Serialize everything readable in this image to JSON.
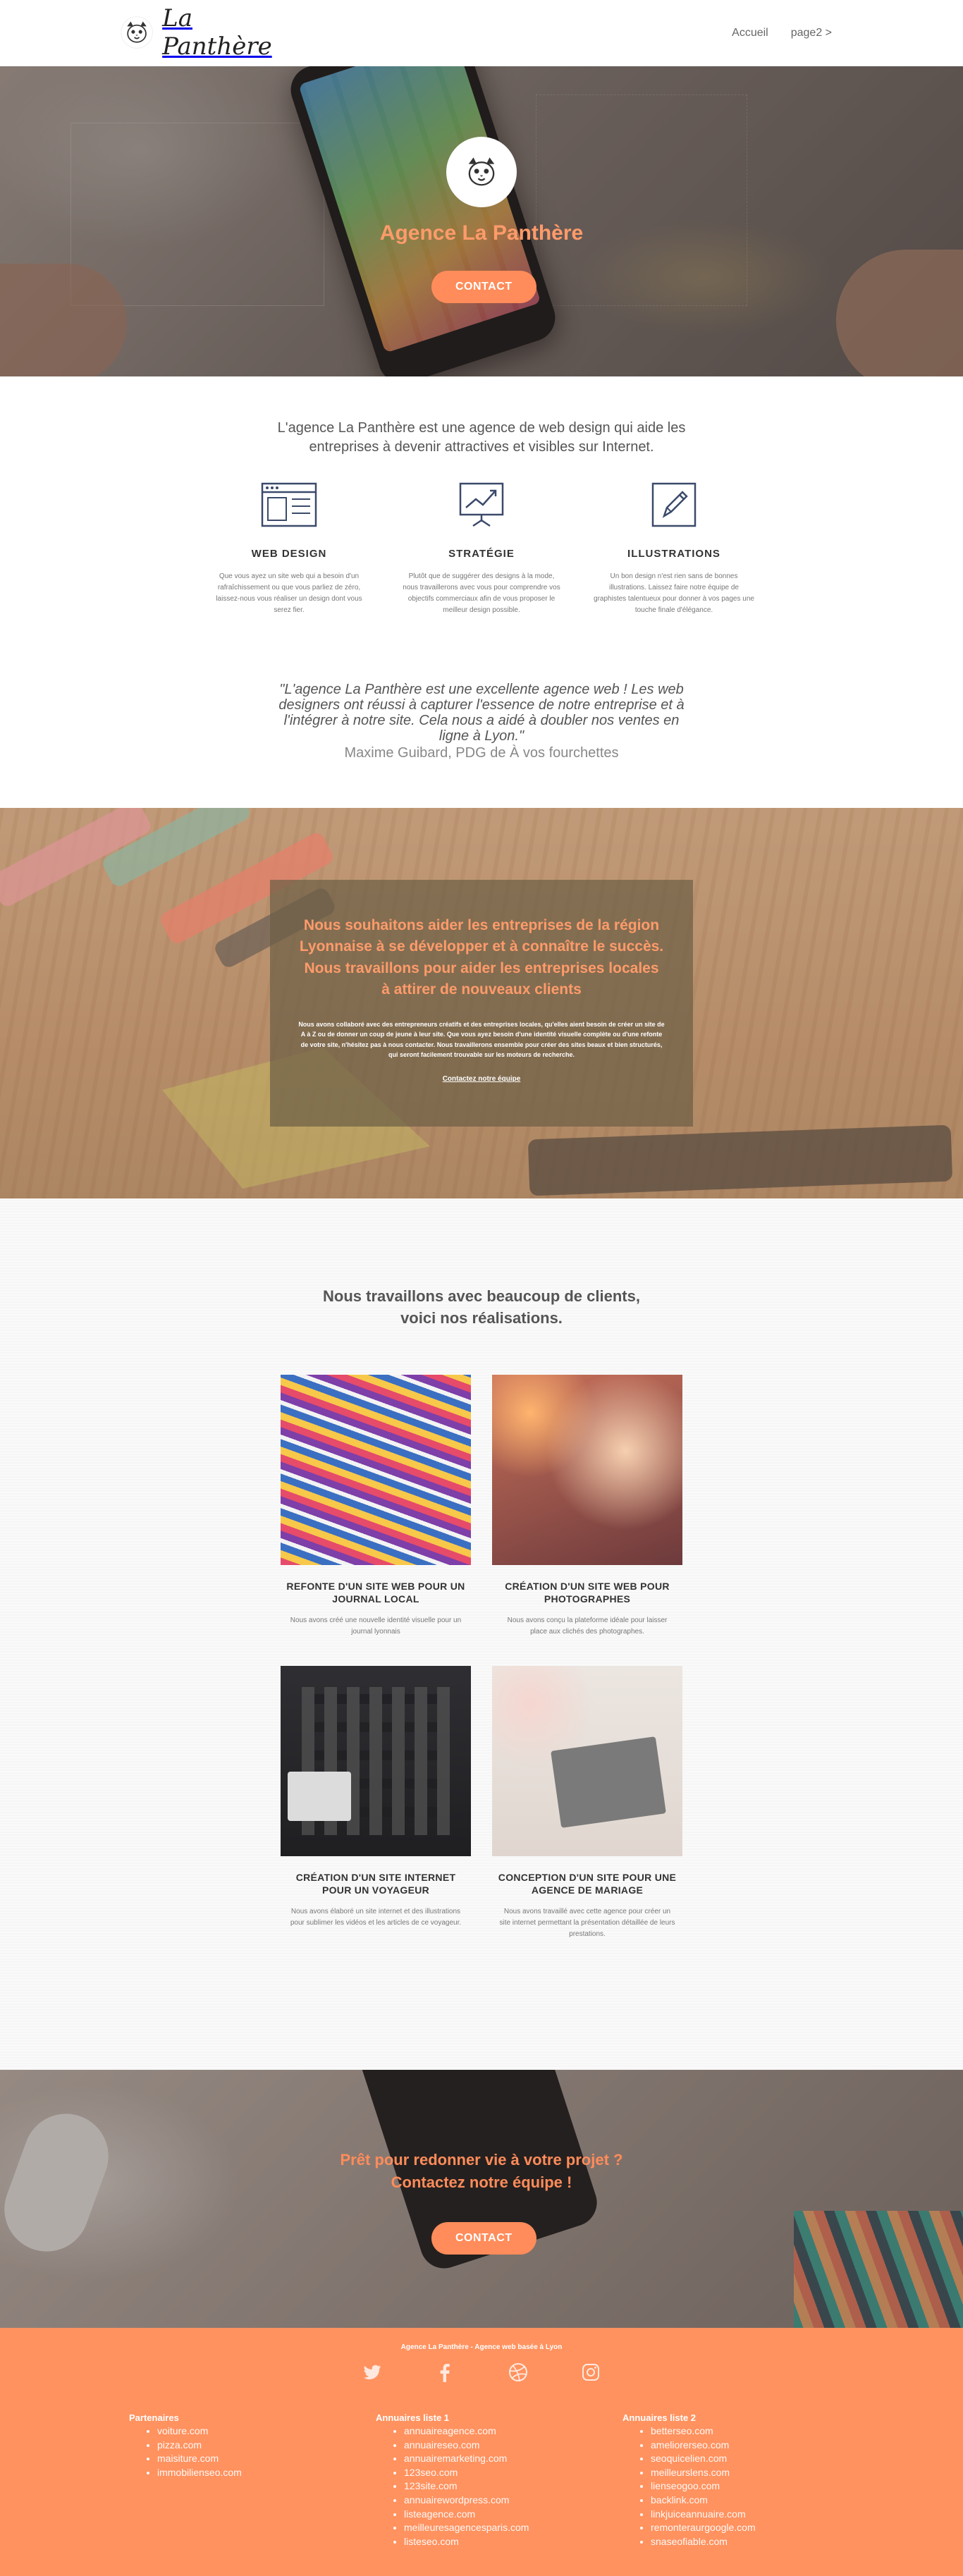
{
  "header": {
    "logo_text": "La Panthère",
    "nav": [
      {
        "label": "Accueil"
      },
      {
        "label": "page2 >"
      }
    ]
  },
  "hero": {
    "title": "Agence La Panthère",
    "button": "CONTACT"
  },
  "intro": {
    "text": "L'agence La Panthère est une agence de web design qui aide les entreprises à devenir attractives et visibles sur Internet."
  },
  "features": [
    {
      "icon": "web-design-icon",
      "title": "WEB DESIGN",
      "desc": "Que vous ayez un site web qui a besoin d'un rafraîchissement ou que vous parliez de zéro, laissez-nous vous réaliser un design dont vous serez fier."
    },
    {
      "icon": "strategy-icon",
      "title": "STRATÉGIE",
      "desc": "Plutôt que de suggérer des designs à la mode, nous travaillerons avec vous pour comprendre vos objectifs commerciaux afin de vous proposer le meilleur design possible."
    },
    {
      "icon": "pen-icon",
      "title": "ILLUSTRATIONS",
      "desc": "Un bon design n'est rien sans de bonnes illustrations. Laissez faire notre équipe de graphistes talentueux pour donner à vos pages une touche finale d'élégance."
    }
  ],
  "quote": {
    "text": "\"L'agence La Panthère est une excellente agence web ! Les web designers ont réussi à capturer l'essence de notre entreprise et à l'intégrer à notre site. Cela nous a aidé à doubler nos ventes en ligne à Lyon.\"",
    "author": "Maxime Guibard, PDG de À vos fourchettes"
  },
  "mission": {
    "title": "Nous souhaitons aider les entreprises de la région Lyonnaise à se développer et à connaître le succès. Nous travaillons pour aider les entreprises locales à attirer de nouveaux clients",
    "text": "Nous avons collaboré avec des entrepreneurs créatifs et des entreprises locales, qu'elles aient besoin de créer un site de A à Z ou de donner un coup de jeune à leur site. Que vous ayez besoin d'une identité visuelle complète ou d'une refonte de votre site, n'hésitez pas à nous contacter. Nous travaillerons ensemble pour créer des sites beaux et bien structurés, qui seront facilement trouvable sur les moteurs de recherche.",
    "link": "Contactez notre équipe"
  },
  "projects": {
    "title_line1": "Nous travaillons avec beaucoup de clients,",
    "title_line2": "voici nos réalisations.",
    "items": [
      {
        "title": "REFONTE D'UN SITE WEB POUR UN JOURNAL LOCAL",
        "desc": "Nous avons créé une nouvelle identité visuelle pour un journal lyonnais"
      },
      {
        "title": "CRÉATION D'UN SITE WEB POUR PHOTOGRAPHES",
        "desc": "Nous avons conçu la plateforme idéale pour laisser place aux clichés des photographes."
      },
      {
        "title": "CRÉATION D'UN SITE INTERNET POUR UN VOYAGEUR",
        "desc": "Nous avons élaboré un site internet et des illustrations pour sublimer les vidéos et les articles de ce voyageur."
      },
      {
        "title": "CONCEPTION D'UN SITE POUR UNE AGENCE DE MARIAGE",
        "desc": "Nous avons travaillé avec cette agence pour créer un site internet permettant la présentation détaillée de leurs prestations."
      }
    ]
  },
  "cta": {
    "title_line1": "Prêt pour redonner vie à votre projet ?",
    "title_line2": "Contactez notre équipe !",
    "button": "CONTACT"
  },
  "footer": {
    "top": "Agence La Panthère - Agence web basée à Lyon",
    "socials": [
      "twitter-icon",
      "facebook-icon",
      "dribbble-icon",
      "instagram-icon"
    ],
    "columns": [
      {
        "title": "Partenaires",
        "items": [
          "voiture.com",
          "pizza.com",
          "maisiture.com",
          "immobilienseo.com"
        ]
      },
      {
        "title": "Annuaires liste 1",
        "items": [
          "annuaireagence.com",
          "annuaireseo.com",
          "annuairemarketing.com",
          "123seo.com",
          "123site.com",
          "annuairewordpress.com",
          "listeagence.com",
          "meilleuresagencesparis.com",
          "listeseo.com"
        ]
      },
      {
        "title": "Annuaires liste 2",
        "items": [
          "betterseo.com",
          "ameliorerseo.com",
          "seoquicelien.com",
          "meilleurslens.com",
          "lienseogoo.com",
          "backlink.com",
          "linkjuiceannuaire.com",
          "remonteraurgoogle.com",
          "snaseofiable.com"
        ]
      }
    ]
  },
  "colors": {
    "accent": "#ff8c5a",
    "footer_bg": "#ff925f"
  }
}
